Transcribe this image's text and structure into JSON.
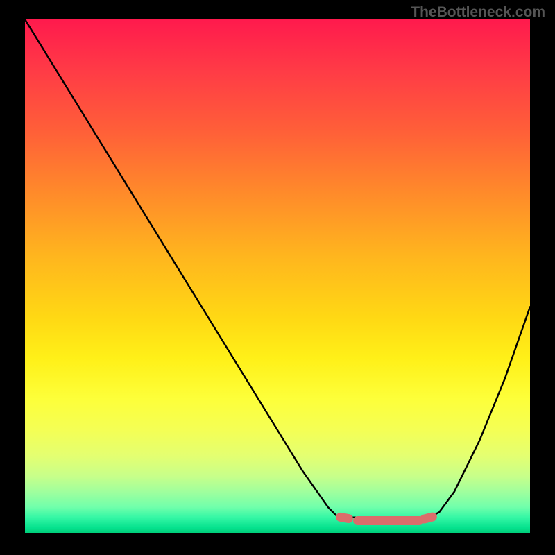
{
  "watermark": "TheBottleneck.com",
  "chart_data": {
    "type": "line",
    "title": "",
    "xlabel": "",
    "ylabel": "",
    "xlim": [
      0,
      100
    ],
    "ylim": [
      0,
      100
    ],
    "x": [
      0,
      5,
      10,
      15,
      20,
      25,
      30,
      35,
      40,
      45,
      50,
      55,
      60,
      62,
      65,
      70,
      75,
      78,
      80,
      82,
      85,
      90,
      95,
      100
    ],
    "y": [
      100,
      92,
      84,
      76,
      68,
      60,
      52,
      44,
      36,
      28,
      20,
      12,
      5,
      3,
      3,
      3,
      3,
      3,
      3,
      4,
      8,
      18,
      30,
      44
    ],
    "flat_segment": {
      "x_start": 62,
      "x_end": 80,
      "y": 3
    },
    "background_gradient": {
      "direction": "top-to-bottom",
      "stops": [
        {
          "pos": 0,
          "color": "#ff1a4d"
        },
        {
          "pos": 50,
          "color": "#ffb51e"
        },
        {
          "pos": 75,
          "color": "#fdff3a"
        },
        {
          "pos": 100,
          "color": "#00cf7a"
        }
      ]
    }
  }
}
